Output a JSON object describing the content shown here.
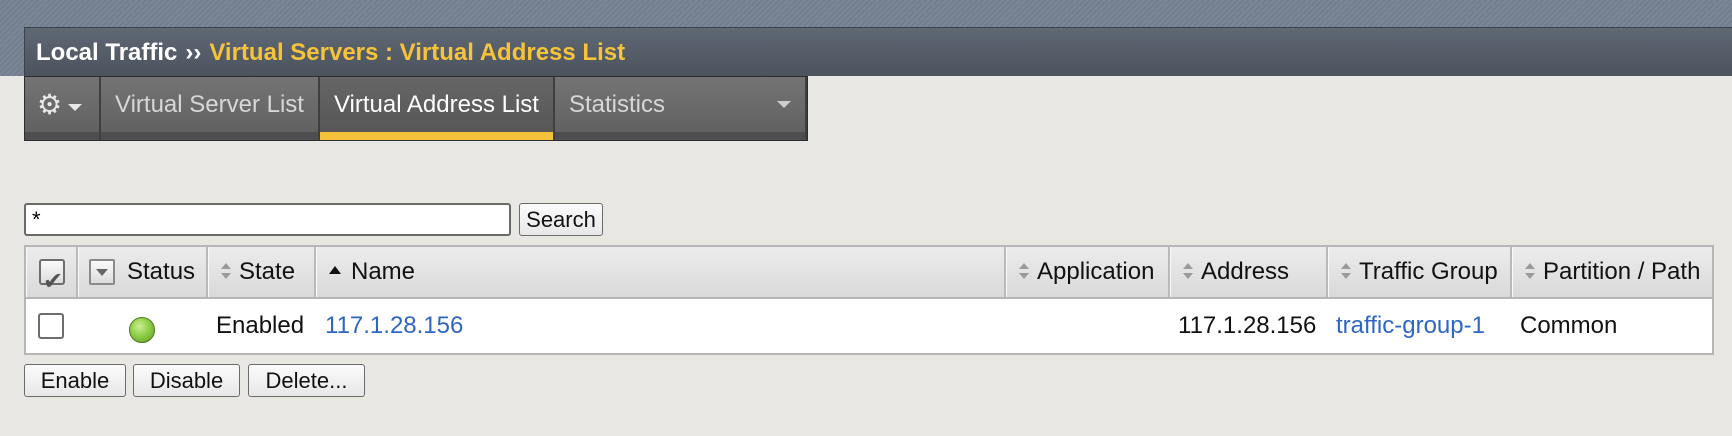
{
  "breadcrumb": {
    "section": "Local Traffic",
    "separator": "››",
    "current": "Virtual Servers : Virtual Address List"
  },
  "tabs": {
    "gear_icon": "gear-icon",
    "items": [
      {
        "label": "Virtual Server List",
        "active": false
      },
      {
        "label": "Virtual Address List",
        "active": true
      },
      {
        "label": "Statistics",
        "active": false
      }
    ]
  },
  "search": {
    "value": "*",
    "button_label": "Search"
  },
  "table": {
    "columns": [
      {
        "label": "Status"
      },
      {
        "label": "State"
      },
      {
        "label": "Name",
        "sorted": "ascending"
      },
      {
        "label": "Application"
      },
      {
        "label": "Address"
      },
      {
        "label": "Traffic Group"
      },
      {
        "label": "Partition / Path"
      }
    ],
    "rows": [
      {
        "selected": false,
        "status": "available",
        "status_color": "#8fcf47",
        "state": "Enabled",
        "name": "117.1.28.156",
        "application": "",
        "address": "117.1.28.156",
        "traffic_group": "traffic-group-1",
        "partition": "Common"
      }
    ]
  },
  "actions": {
    "enable": "Enable",
    "disable": "Disable",
    "delete": "Delete..."
  },
  "colors": {
    "accent": "#f4c23b",
    "link": "#2e66c5",
    "title_bar": "#55606c"
  }
}
